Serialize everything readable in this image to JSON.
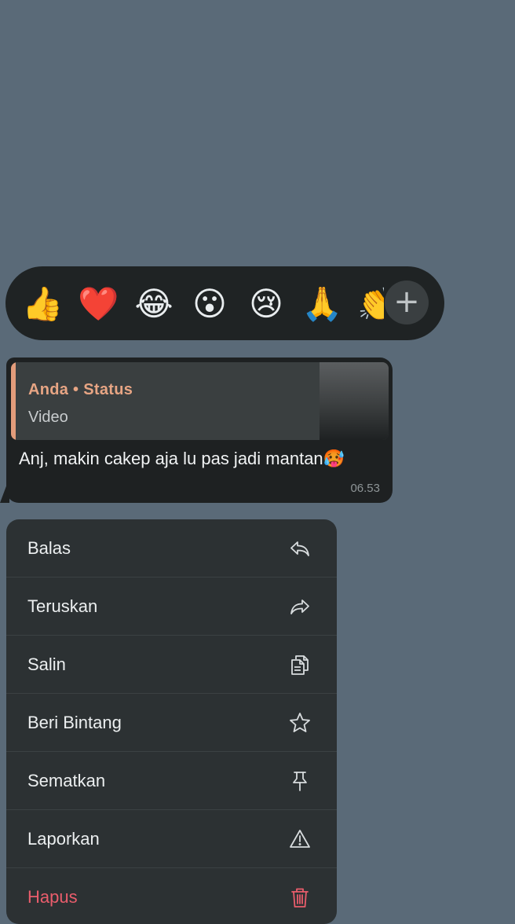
{
  "reactions": [
    {
      "emoji": "👍",
      "name": "thumbs-up"
    },
    {
      "emoji": "❤️",
      "name": "red-heart"
    },
    {
      "emoji": "😂",
      "name": "tears-of-joy"
    },
    {
      "emoji": "😮",
      "name": "open-mouth"
    },
    {
      "emoji": "😢",
      "name": "crying-face"
    },
    {
      "emoji": "🙏",
      "name": "folded-hands"
    },
    {
      "emoji": "👏",
      "name": "clapping-hands"
    }
  ],
  "add_reaction_symbol": "+",
  "message": {
    "quote_author": "Anda • Status",
    "quote_type": "Video",
    "text": "Anj, makin cakep aja lu pas jadi mantan🥵",
    "time": "06.53"
  },
  "menu": {
    "items": [
      {
        "label": "Balas",
        "icon": "reply-icon"
      },
      {
        "label": "Teruskan",
        "icon": "forward-icon"
      },
      {
        "label": "Salin",
        "icon": "copy-icon"
      },
      {
        "label": "Beri Bintang",
        "icon": "star-icon"
      },
      {
        "label": "Sematkan",
        "icon": "pin-icon"
      },
      {
        "label": "Laporkan",
        "icon": "warning-icon"
      },
      {
        "label": "Hapus",
        "icon": "trash-icon"
      }
    ]
  },
  "colors": {
    "background": "#5a6a78",
    "panel": "#1e2122",
    "menu": "#2c3133",
    "quote_accent": "#e29c7b",
    "danger": "#ea5d6c"
  }
}
